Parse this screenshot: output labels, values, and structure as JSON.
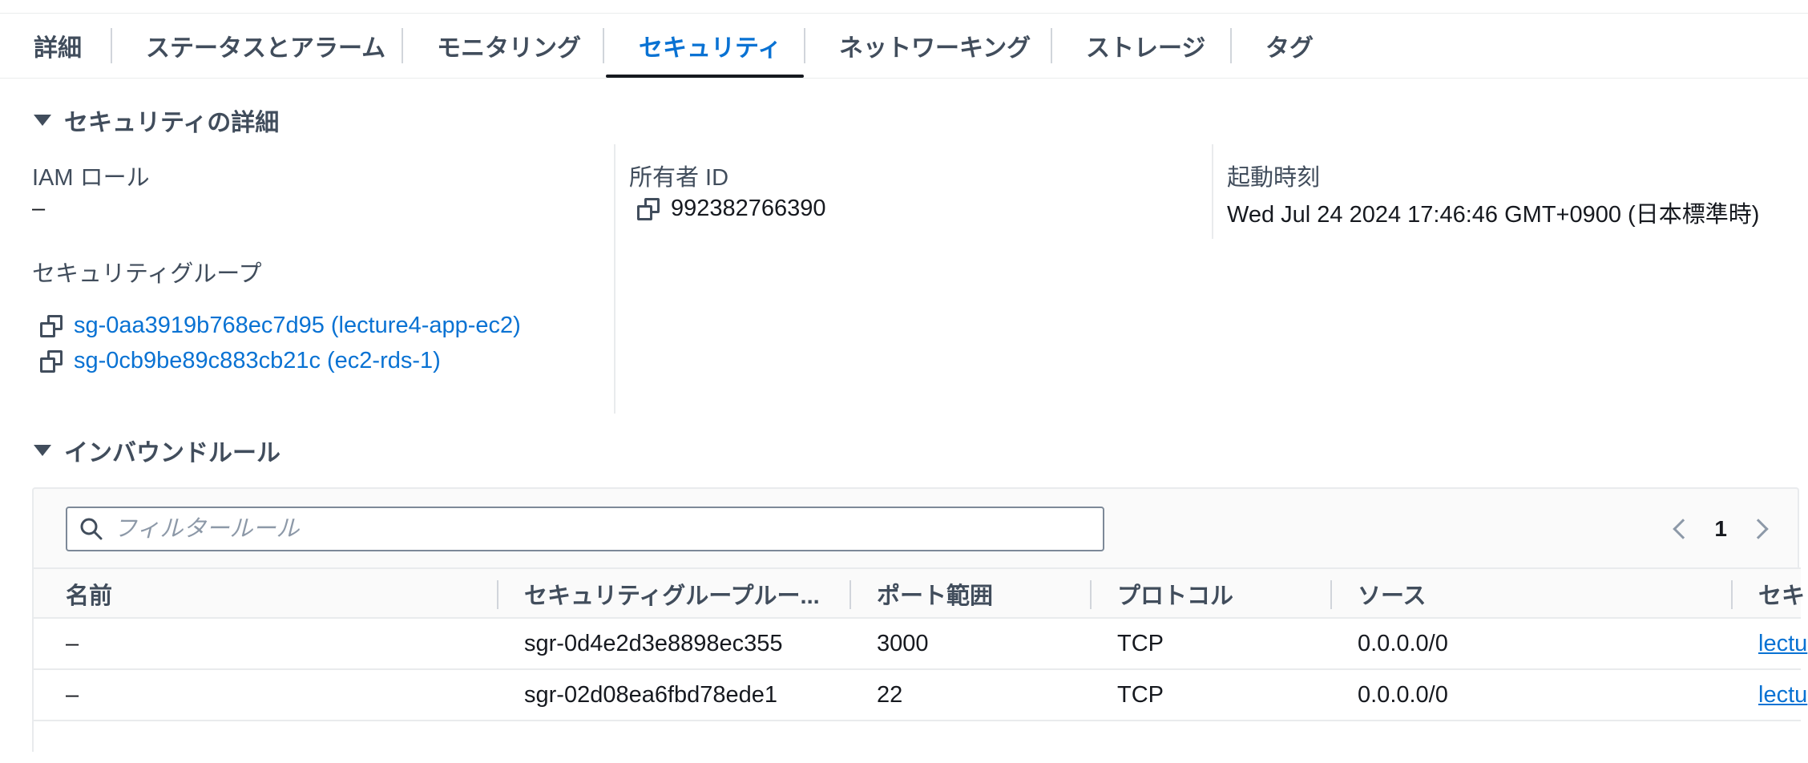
{
  "tabs": [
    {
      "label": "詳細"
    },
    {
      "label": "ステータスとアラーム"
    },
    {
      "label": "モニタリング"
    },
    {
      "label": "セキュリティ",
      "active": true
    },
    {
      "label": "ネットワーキング"
    },
    {
      "label": "ストレージ"
    },
    {
      "label": "タグ"
    }
  ],
  "security_details": {
    "heading": "セキュリティの詳細",
    "iam_role_label": "IAM ロール",
    "iam_role_value": "–",
    "owner_id_label": "所有者 ID",
    "owner_id_value": "992382766390",
    "launch_time_label": "起動時刻",
    "launch_time_value": "Wed Jul 24 2024 17:46:46 GMT+0900 (日本標準時)",
    "security_groups_label": "セキュリティグループ",
    "security_groups": [
      {
        "label": "sg-0aa3919b768ec7d95 (lecture4-app-ec2)"
      },
      {
        "label": "sg-0cb9be89c883cb21c (ec2-rds-1)"
      }
    ]
  },
  "inbound_rules": {
    "heading": "インバウンドルール",
    "filter_placeholder": "フィルタールール",
    "page": "1",
    "columns": [
      "名前",
      "セキュリティグループルー...",
      "ポート範囲",
      "プロトコル",
      "ソース",
      "セキ"
    ],
    "rows": [
      {
        "name": "–",
        "rule_id": "sgr-0d4e2d3e8898ec355",
        "port": "3000",
        "protocol": "TCP",
        "source": "0.0.0.0/0",
        "sg": "lectu"
      },
      {
        "name": "–",
        "rule_id": "sgr-02d08ea6fbd78ede1",
        "port": "22",
        "protocol": "TCP",
        "source": "0.0.0.0/0",
        "sg": "lectu"
      }
    ]
  },
  "colors": {
    "accent": "#0972d3",
    "text": "#16191f",
    "muted": "#414d5c"
  }
}
